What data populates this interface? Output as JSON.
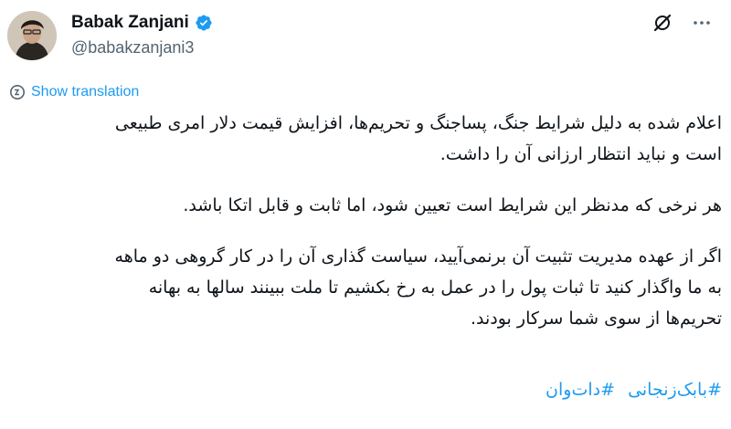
{
  "author": {
    "display_name": "Babak Zanjani",
    "handle": "@babakzanjani3",
    "verified": true
  },
  "icons": {
    "verified": "verified-badge-icon",
    "grok": "grok-icon",
    "more": "more-icon",
    "translate": "translate-icon"
  },
  "colors": {
    "link": "#1d9bf0",
    "text": "#0f1419",
    "secondary": "#536471"
  },
  "translate_label": "Show translation",
  "tweet": {
    "paragraphs": [
      [
        "اعلام شده به دلیل شرایط جنگ، پساجنگ و تحریم‌ها، افزایش قیمت دلار امری طبیعی",
        "است و نباید انتظار ارزانی آن را داشت."
      ],
      [
        "هر نرخی که مدنظر این شرایط است تعیین شود، اما ثابت و قابل اتکا باشد."
      ],
      [
        "اگر از عهده مدیریت تثبیت آن برنمی‌آیید، سیاست گذاری  آن را در کار گروهی دو ماهه",
        "به ما واگذار کنید تا ثبات پول را در عمل به رخ بکشیم تا ملت ببینند سالها به بهانه",
        "تحریم‌ها از سوی شما سرکار بودند."
      ]
    ],
    "hashtags": [
      "#بابک‌زنجانی",
      "#دات‌وان"
    ]
  }
}
